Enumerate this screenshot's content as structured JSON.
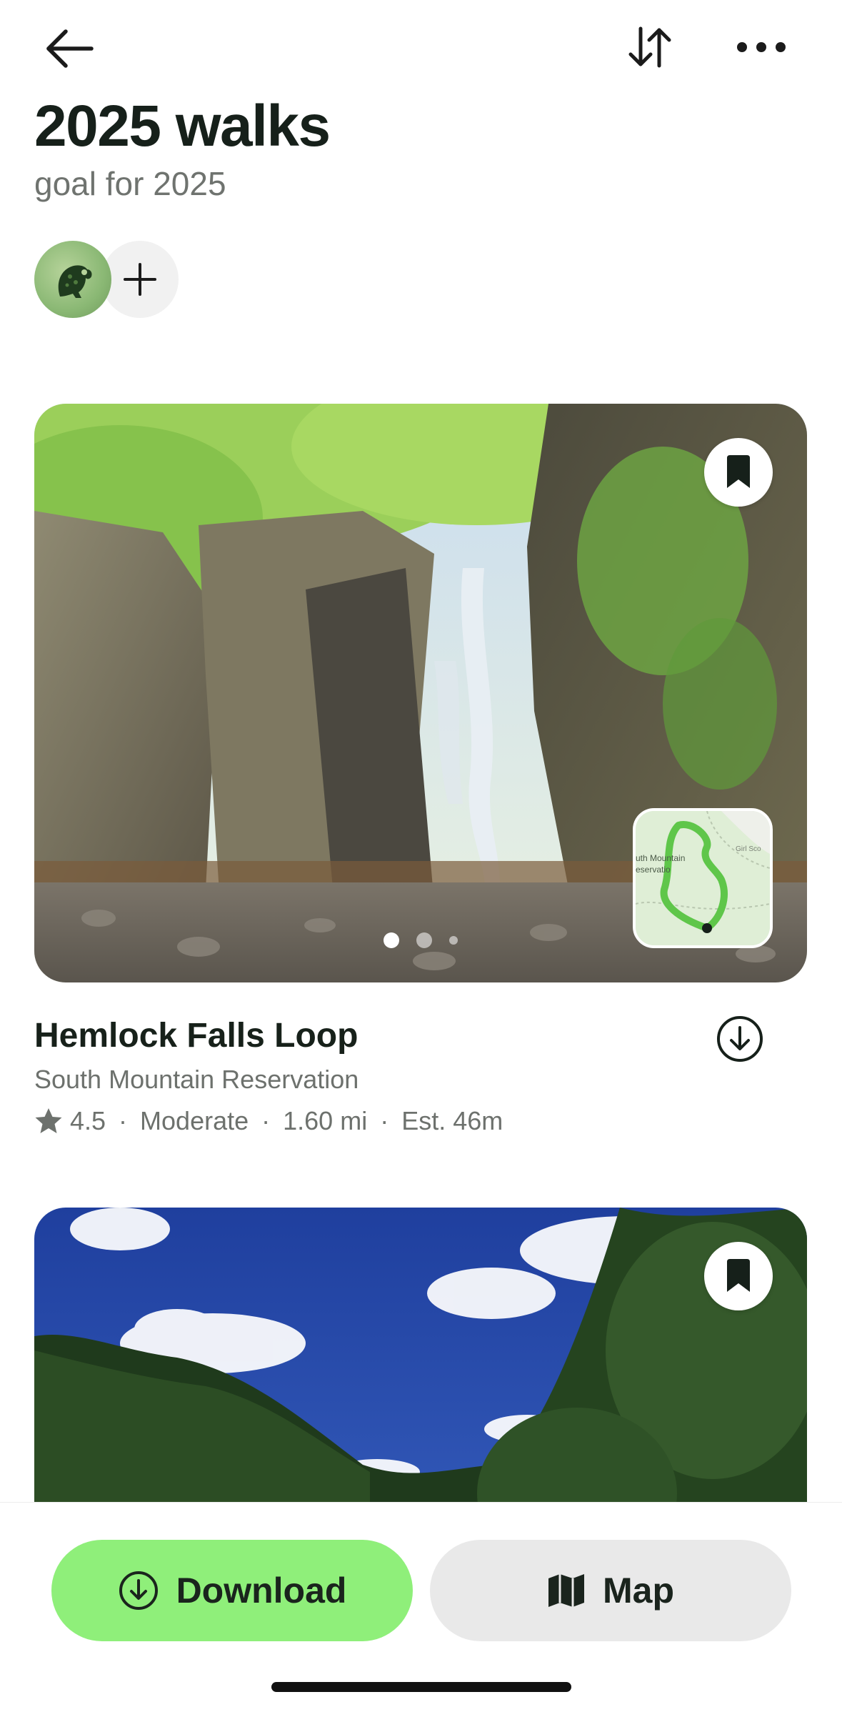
{
  "header": {
    "back_icon": "arrow-left-icon",
    "sort_icon": "sort-arrows-icon",
    "more_icon": "more-horizontal-icon"
  },
  "list": {
    "title": "2025 walks",
    "subtitle": "goal for 2025",
    "member_avatar_icon": "frog-avatar-icon",
    "add_member_icon": "plus-icon"
  },
  "trails": [
    {
      "name": "Hemlock Falls Loop",
      "location": "South Mountain Reservation",
      "rating": "4.5",
      "difficulty": "Moderate",
      "length": "1.60 mi",
      "estimate": "Est. 46m",
      "separator": "·",
      "photo_count": 3,
      "active_photo": 1,
      "map_label_1": "uth Mountain",
      "map_label_2": "eservatio",
      "map_label_3": "Girl Sco"
    },
    {
      "name": "",
      "location": ""
    }
  ],
  "actions": {
    "download_label": "Download",
    "map_label": "Map"
  },
  "colors": {
    "accent_green": "#8fef7a",
    "secondary_gray": "#e9e9e9",
    "trail_line": "#5fc64a"
  }
}
